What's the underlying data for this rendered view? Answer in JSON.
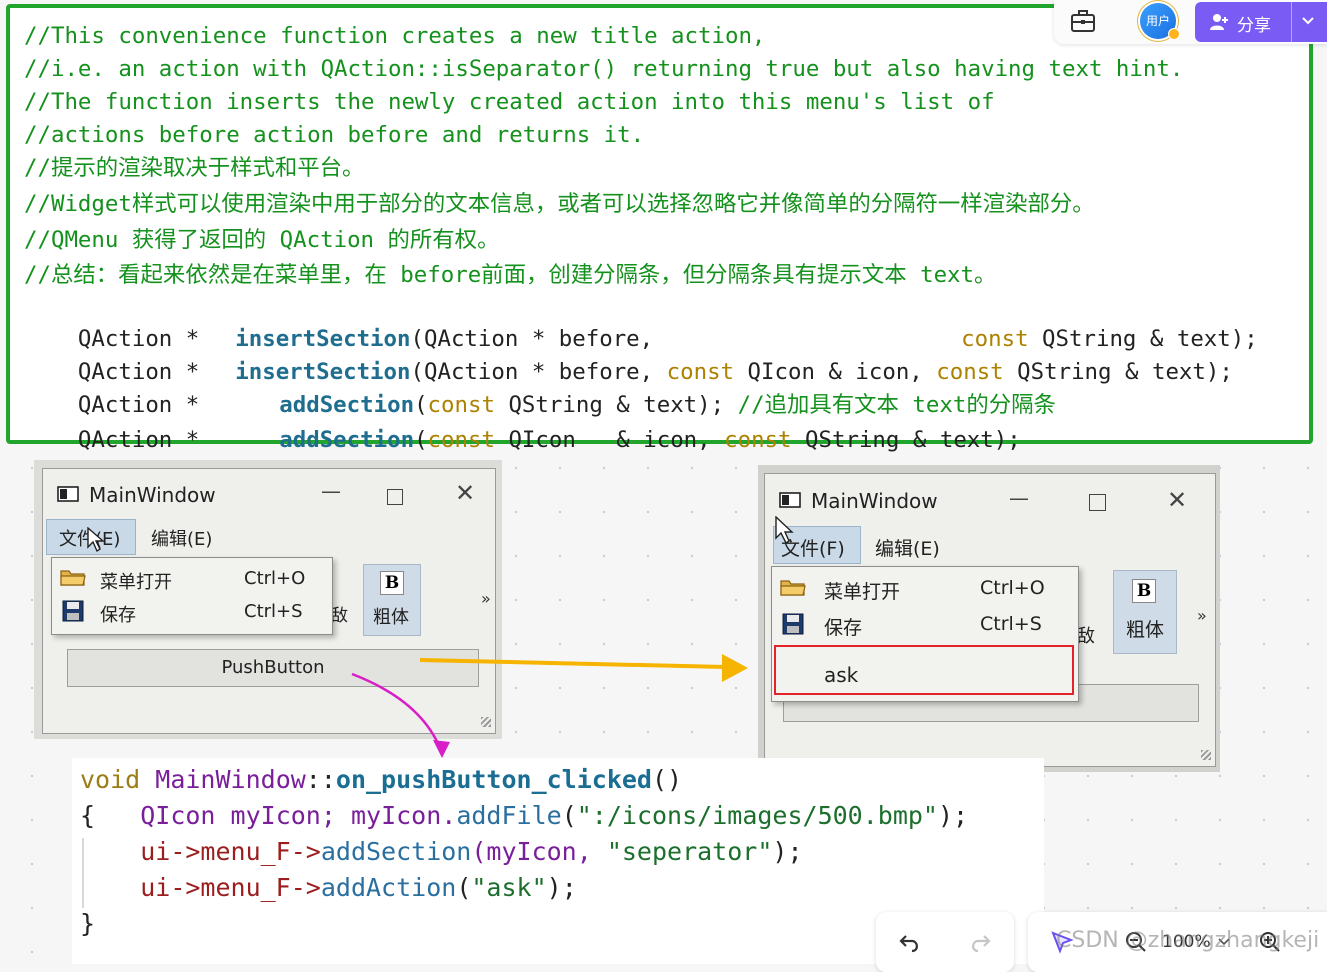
{
  "code_top": {
    "comments": [
      "//This convenience function creates a new title action,",
      "//i.e. an action with QAction::isSeparator() returning true but also having text hint.",
      "//The function inserts the newly created action into this menu's list of",
      "//actions before action before and returns it.",
      "//提示的渲染取决于样式和平台。",
      "//Widget样式可以使用渲染中用于部分的文本信息，或者可以选择忽略它并像简单的分隔符一样渲染部分。",
      "//QMenu 获得了返回的 QAction 的所有权。",
      "//总结：看起来依然是在菜单里，在 before前面，创建分隔条，但分隔条具有提示文本 text。"
    ],
    "decl1": {
      "ret": "QAction *",
      "fn": "insertSection",
      "a": "(QAction * before,",
      "kw": "const",
      "b": "QString & text);"
    },
    "decl2": {
      "ret": "QAction *",
      "fn": "insertSection",
      "a": "(QAction * before,",
      "kw1": "const",
      "b": "QIcon & icon,",
      "kw2": "const",
      "c": "QString & text);"
    },
    "decl3": {
      "ret": "QAction *",
      "fn": "addSection",
      "p": "(",
      "kw": "const",
      "a": "QString & text);",
      "cmt": "//追加具有文本 text的分隔条"
    },
    "decl4": {
      "ret": "QAction *",
      "fn": "addSection",
      "p": "(",
      "kw1": "const",
      "a": "QIcon   & icon,",
      "kw2": "const",
      "b": "QString & text);"
    }
  },
  "toolbar": {
    "avatar_label": "用户",
    "share_label": "分享"
  },
  "screenshot_left": {
    "title": "MainWindow",
    "menu_file": "文件(E)",
    "menu_edit": "编辑(E)",
    "items": [
      {
        "label": "菜单打开",
        "shortcut": "Ctrl+O"
      },
      {
        "label": "保存",
        "shortcut": "Ctrl+S"
      }
    ],
    "partial_text": "敌",
    "bold_letter": "B",
    "bold_label": "粗体",
    "more": "»",
    "push_button": "PushButton"
  },
  "screenshot_right": {
    "title": "MainWindow",
    "menu_file": "文件(F)",
    "menu_edit": "编辑(E)",
    "items": [
      {
        "label": "菜单打开",
        "shortcut": "Ctrl+O"
      },
      {
        "label": "保存",
        "shortcut": "Ctrl+S"
      }
    ],
    "partial_text": "敌",
    "bold_letter": "B",
    "bold_label": "粗体",
    "more": "»",
    "ask": "ask"
  },
  "code_bottom": {
    "l1": {
      "kw": "void",
      "cls": "MainWindow",
      "sep": "::",
      "fn": "on_pushButton_clicked",
      "end": "()"
    },
    "l2": {
      "brace": "{",
      "cls": "QIcon",
      "v1": "myIcon;",
      "v2": "myIcon.",
      "fn": "addFile",
      "p": "(",
      "str": "\":/icons/images/500.bmp\"",
      "end": ");"
    },
    "l3": {
      "mem": "ui->menu_F->",
      "fn": "addSection",
      "p": "(myIcon, ",
      "str": "\"seperator\"",
      "end": ");"
    },
    "l4": {
      "mem": "ui->menu_F->",
      "fn": "addAction",
      "p": "(",
      "str": "\"ask\"",
      "end": ");"
    },
    "l5": {
      "brace": "}"
    }
  },
  "bottom_toolbar": {
    "zoom": "100%",
    "watermark": "CSDN @zhangzhangkeji"
  },
  "colors": {
    "frame_green": "#21a52c",
    "share_purple": "#7a5cf5",
    "arrow_orange": "#f6b400",
    "arrow_magenta": "#d81ec8",
    "highlight_red": "#e5212a"
  }
}
